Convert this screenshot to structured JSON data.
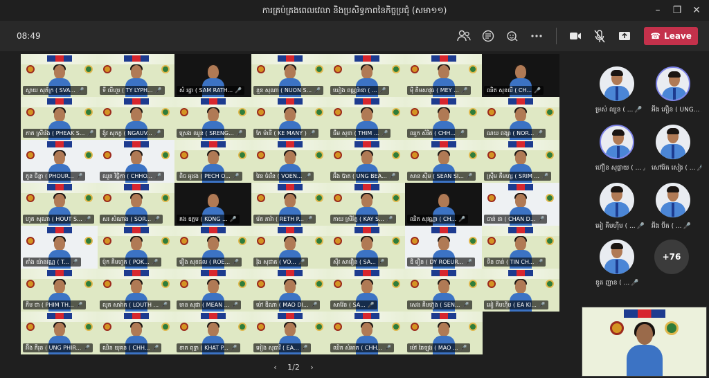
{
  "window": {
    "title": "ការគ្រប់គ្រងពេលវេលា និងប្រសិទ្ធភាពនៃកិច្ចប្រជុំ (សមា១១)",
    "minimize_icon": "minimize-icon",
    "maximize_icon": "restore-icon",
    "close_icon": "close-icon"
  },
  "toolbar": {
    "timer": "08:49",
    "leave_label": "Leave",
    "leave_color": "#c4314b",
    "buttons": [
      "people-icon",
      "chat-icon",
      "reactions-icon",
      "more-icon",
      "camera-icon",
      "mic-muted-icon",
      "share-icon"
    ]
  },
  "grid": {
    "tiles": [
      "ស្វាយ សុភ័ក្រ ( SVA...",
      "ទី លីហួរ ( TY LYPH...",
      "សំ រដ្ឋា ( SAM RATH...",
      "នួន សុណា ( NUON S...",
      "ឃៀង ពណ្ណរ៉ាឌា ( ...",
      "ម៉ី គីមសាវុធ ( MEY ...",
      "ឈិត សុខលី ( CH...",
      "ភាគ ស្រីរ៉េង ( PHEAK S...",
      "ង៉ូវ សុភក្ត ( NGAUV...",
      "ស្រេង ឈួន ( SRENG...",
      "កែ ម៉ានី ( KE MANY )",
      "ធឹម សុខា ( THIM ...",
      "ឈួក សំរិត ( CHH...",
      "ណយ ពង្សា ( NOR...",
      "ភួន ចិន្តា ( PHOUR...",
      "ឈួន វិច្ឆិកា ( CHHO...",
      "ពិច អូដង ( PECH O...",
      "វៃន ចំរើន ( VOEN...",
      "អ៊ឹង ប៊ាត ( UNG BEA...",
      "សាន ស៊ីម ( SEAN SI...",
      "ស្រ៊ឹម គឹមហ្ស ( SRIM ...",
      "ហូត សុណា ( HOUT S...",
      "សរ សំណាង ( SOR...",
      "គង ឧត្តម ( KONG ...",
      "រ៉េត ភារ៉ា ( RETH P...",
      "កាយ ស្រីរ័ត្ន ( KAY S...",
      "ឈិត សុវណ្ណា ( CH...",
      "ចាន់ ដា ( CHAN D...",
      "តាំង យ៉ានវណ្ណ ( T...",
      "ប៉ុក គីមហួត ( POK...",
      "រឿង សុខផល ( ROE...",
      "វ៉ុង សុផាត ( VO...",
      "ស៊ីវ សាវឿន ( SA...",
      "ឌី រឿន ( DY ROEUR...",
      "ទីន ចាន់ ( TIN CH...",
      "ភីម ថា ( PHIM TH...",
      "លូត សារ៉ាត ( LOUTH ...",
      "មាន សុផា ( MEAN ...",
      "ម៉ៅ ឌីណា ( MAO DI...",
      "សាវ៉ែន ( SA...",
      "សេង គីមហ៊ួង ( SEN...",
      "អៀ គីមហ៊ីម ( EA KI...",
      "អ៊ឹង ភីរុន ( UNG PHIR...",
      "ឈិន យុគន ( CHH...",
      "ខាត ពុទ្ធា ( KHAT P...",
      "អៀង សុធាវី ( EA...",
      "ឈិត សំអាត ( CHH...",
      "ម៉ៅ ឆៃឡុង ( MAO ..."
    ]
  },
  "pager": {
    "prev_icon": "chevron-left-icon",
    "label": "1/2",
    "next_icon": "chevron-right-icon"
  },
  "panel": {
    "participants": [
      "ម្រស់ ឈួន ( ...",
      "អ៊ឹង ភឿន ( UNG...",
      "ហ៊ឿន សុផ្លាយ ( ...",
      "សៅរ៉ែត សៀរ ( ...",
      "អៀ គីមហ៊ីម ( ...",
      "អ៊ឹង ប៊ីត ( ...",
      "ឌួត ញាន ( ..."
    ],
    "more_label": "+76"
  }
}
